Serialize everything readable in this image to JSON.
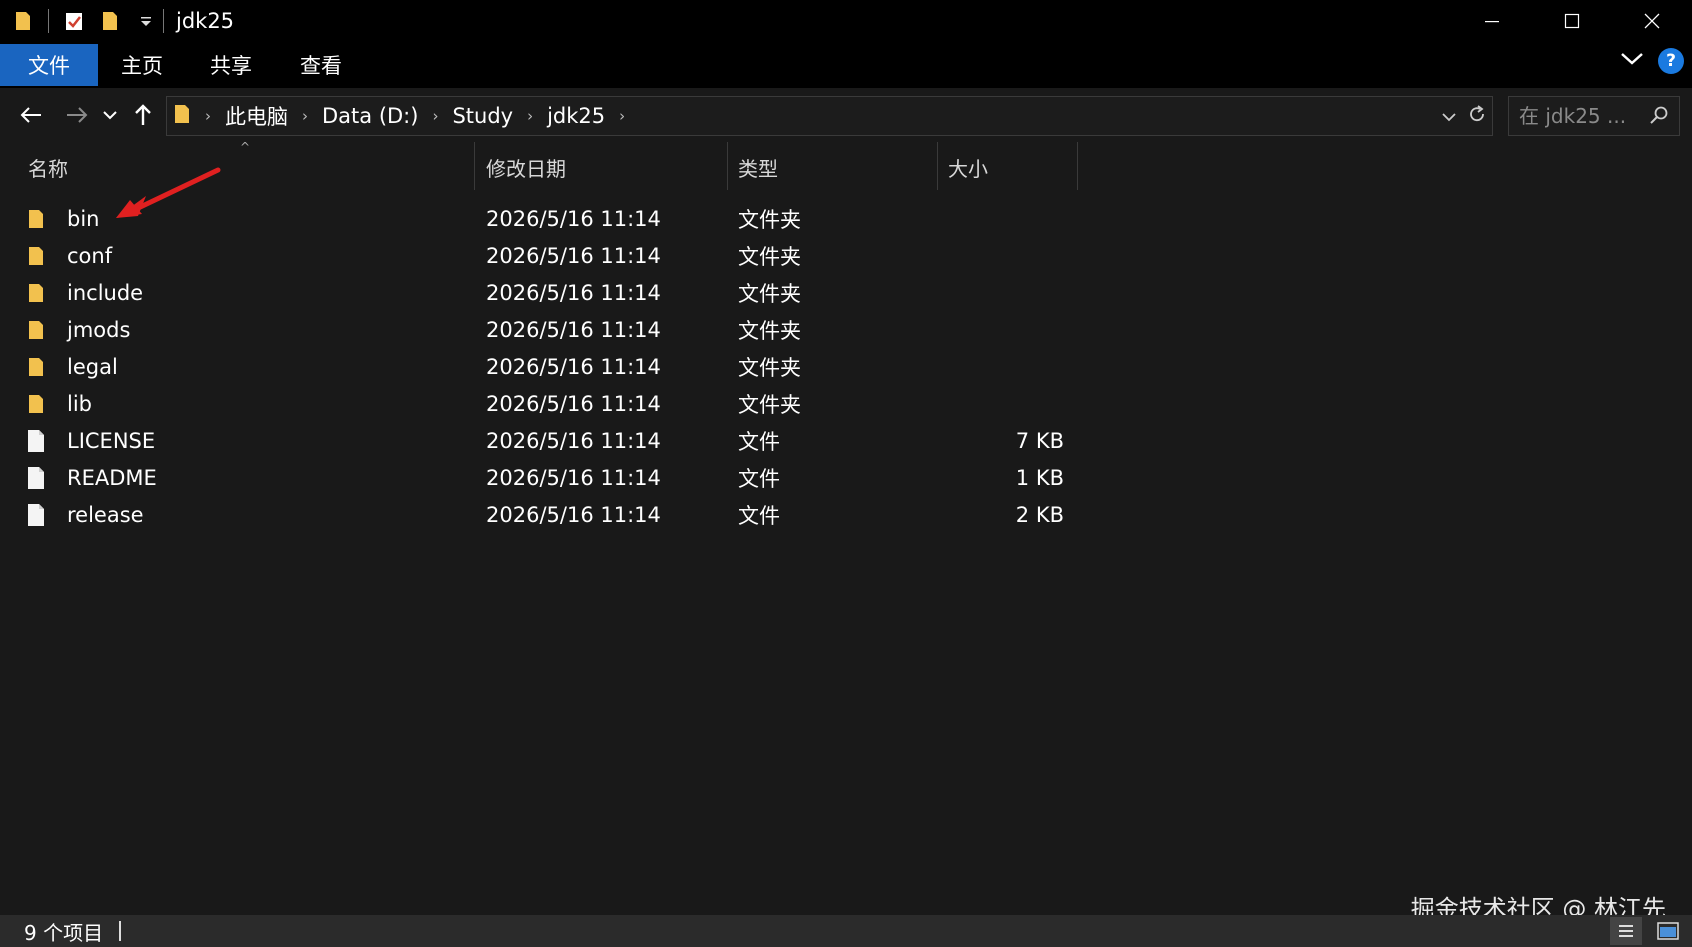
{
  "window": {
    "title": "jdk25",
    "controls": [
      "minimize",
      "maximize",
      "close"
    ]
  },
  "ribbon": {
    "tabs": [
      {
        "label": "文件",
        "active": true
      },
      {
        "label": "主页"
      },
      {
        "label": "共享"
      },
      {
        "label": "查看"
      }
    ],
    "help_label": "?"
  },
  "address": {
    "crumbs": [
      "此电脑",
      "Data (D:)",
      "Study",
      "jdk25"
    ]
  },
  "search": {
    "placeholder": "在 jdk25 ..."
  },
  "columns": {
    "name": "名称",
    "date": "修改日期",
    "type": "类型",
    "size": "大小"
  },
  "files": [
    {
      "name": "bin",
      "date": "2026/5/16 11:14",
      "type": "文件夹",
      "size": "",
      "kind": "folder"
    },
    {
      "name": "conf",
      "date": "2026/5/16 11:14",
      "type": "文件夹",
      "size": "",
      "kind": "folder"
    },
    {
      "name": "include",
      "date": "2026/5/16 11:14",
      "type": "文件夹",
      "size": "",
      "kind": "folder"
    },
    {
      "name": "jmods",
      "date": "2026/5/16 11:14",
      "type": "文件夹",
      "size": "",
      "kind": "folder"
    },
    {
      "name": "legal",
      "date": "2026/5/16 11:14",
      "type": "文件夹",
      "size": "",
      "kind": "folder"
    },
    {
      "name": "lib",
      "date": "2026/5/16 11:14",
      "type": "文件夹",
      "size": "",
      "kind": "folder"
    },
    {
      "name": "LICENSE",
      "date": "2026/5/16 11:14",
      "type": "文件",
      "size": "7 KB",
      "kind": "file"
    },
    {
      "name": "README",
      "date": "2026/5/16 11:14",
      "type": "文件",
      "size": "1 KB",
      "kind": "file"
    },
    {
      "name": "release",
      "date": "2026/5/16 11:14",
      "type": "文件",
      "size": "2 KB",
      "kind": "file"
    }
  ],
  "status": {
    "item_count": "9 个项目"
  },
  "watermark": "掘金技术社区 @ 林江先",
  "colors": {
    "accent": "#1a65c0",
    "folder": "#f2c14e",
    "annotation_arrow": "#e02020",
    "background": "#191919"
  },
  "icons": {
    "folder": "folder-icon",
    "file": "file-icon"
  }
}
